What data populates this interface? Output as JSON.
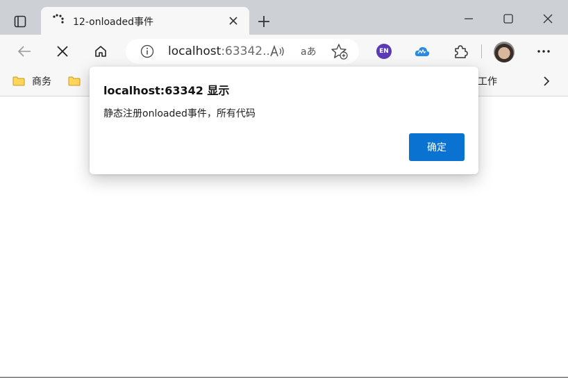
{
  "tab": {
    "title": "12-onloaded事件"
  },
  "address": {
    "host": "localhost",
    "port_truncated": ":63342..."
  },
  "extensions": {
    "en_badge": "EN"
  },
  "bookmarks": {
    "items": [
      "商务",
      "工作"
    ]
  },
  "dialog": {
    "title": "localhost:63342 显示",
    "message": "静态注册onloaded事件，所有代码",
    "ok_label": "确定"
  },
  "colors": {
    "titlebar": "#cdd1d6",
    "toolbar": "#f7f7f7",
    "accent_button": "#0a72d1",
    "extension_en": "#5b3bb5"
  }
}
